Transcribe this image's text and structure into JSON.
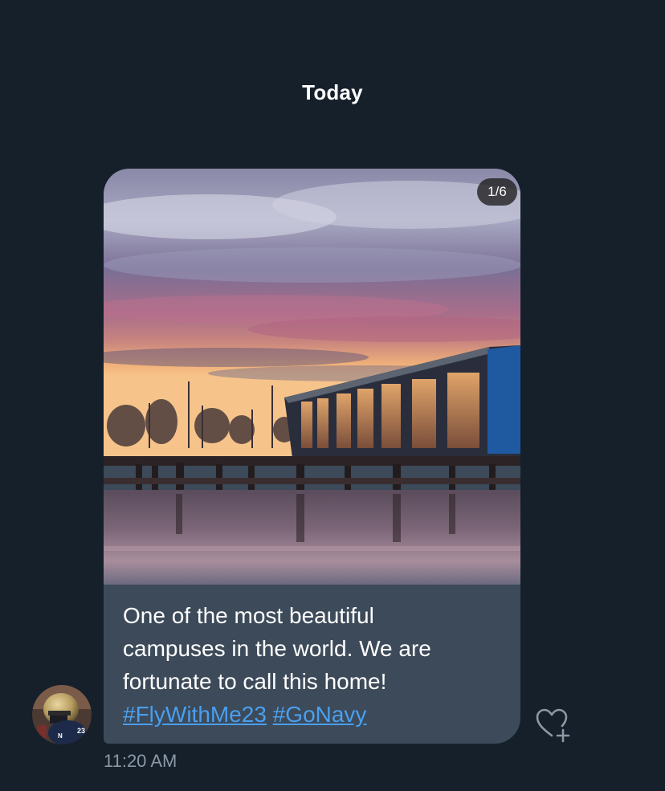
{
  "conversation": {
    "date_separator": "Today"
  },
  "message": {
    "media": {
      "counter": "1/6",
      "description": "sunset over marina with glass building"
    },
    "text_lines": [
      "One of the most beautiful",
      "campuses in the world. We are",
      "fortunate to call this home!"
    ],
    "hashtags": [
      "#FlyWithMe23",
      "#GoNavy"
    ],
    "timestamp": "11:20 AM",
    "sender_avatar": {
      "jersey_number": "23",
      "helmet_letter": "N"
    }
  },
  "icons": {
    "react": "heart-plus-icon"
  },
  "colors": {
    "background": "#15202b",
    "bubble": "#3c4a59",
    "link": "#4a9ff0",
    "timestamp": "#8b98a5"
  }
}
